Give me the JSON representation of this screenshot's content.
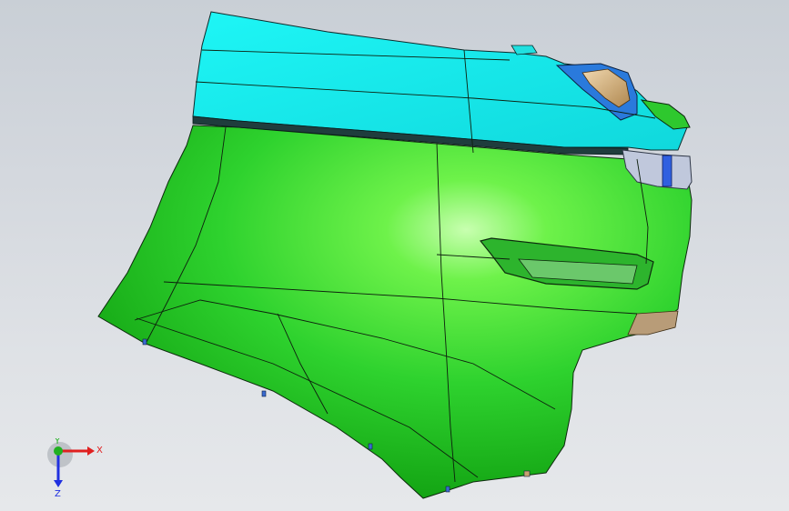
{
  "viewport": {
    "background_top": "#c9cfd6",
    "background_bottom": "#e6e8eb"
  },
  "model": {
    "upper_panel_color": "#19f0f0",
    "lower_panel_color": "#2ed22e",
    "edge_color": "#1a1a1a"
  },
  "triad": {
    "x_label": "X",
    "y_label": "Y",
    "z_label": "Z",
    "x_color": "#e02020",
    "y_color": "#20b020",
    "z_color": "#2030e0"
  }
}
